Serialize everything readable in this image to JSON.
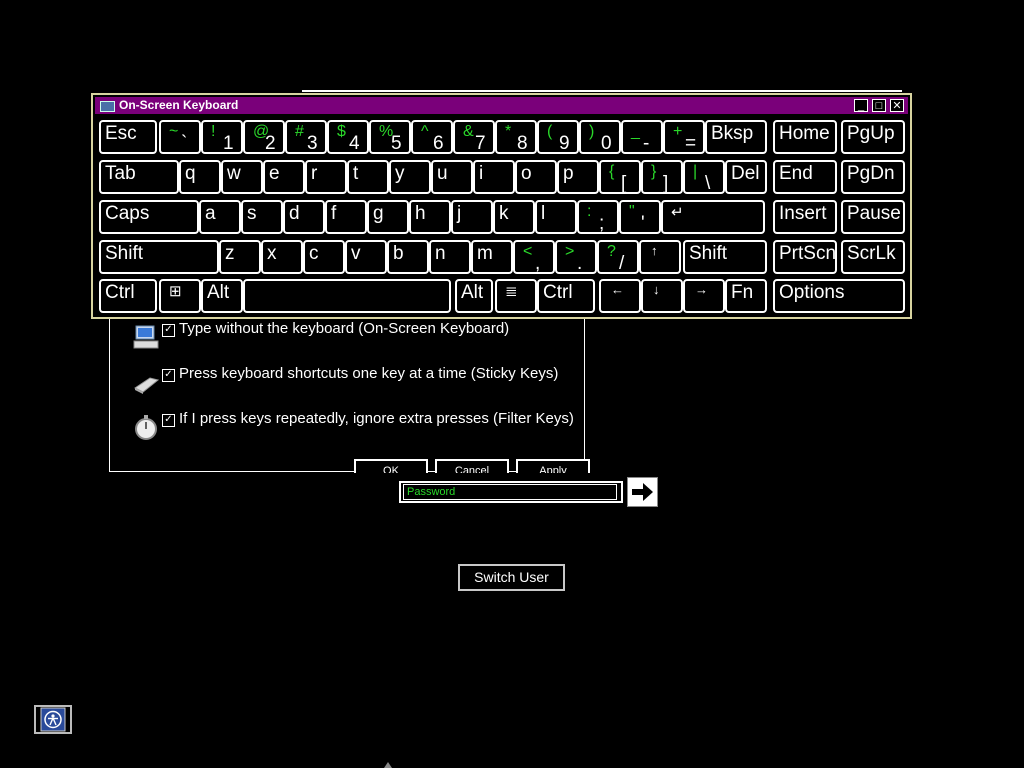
{
  "ease_dialog": {
    "options": [
      {
        "label": "Type without the keyboard (On-Screen Keyboard)",
        "checked": true,
        "icon": "monitor-keyboard-icon"
      },
      {
        "label": "Press keyboard shortcuts one key at a time (Sticky Keys)",
        "checked": true,
        "icon": "sticky-keys-icon"
      },
      {
        "label": "If I press keys repeatedly, ignore extra presses (Filter Keys)",
        "checked": true,
        "icon": "stopwatch-icon"
      }
    ],
    "buttons": {
      "ok": "OK",
      "cancel": "Cancel",
      "apply": "Apply"
    }
  },
  "osk": {
    "title": "On-Screen Keyboard",
    "rows": [
      [
        {
          "label": "Esc"
        },
        {
          "sup": "~",
          "sub": "`"
        },
        {
          "sup": "!",
          "sub": "1"
        },
        {
          "sup": "@",
          "sub": "2"
        },
        {
          "sup": "#",
          "sub": "3"
        },
        {
          "sup": "$",
          "sub": "4"
        },
        {
          "sup": "%",
          "sub": "5"
        },
        {
          "sup": "^",
          "sub": "6"
        },
        {
          "sup": "&",
          "sub": "7"
        },
        {
          "sup": "*",
          "sub": "8"
        },
        {
          "sup": "(",
          "sub": "9"
        },
        {
          "sup": ")",
          "sub": "0"
        },
        {
          "sup": "_",
          "sub": "-"
        },
        {
          "sup": "+",
          "sub": "="
        },
        {
          "label": "Bksp"
        },
        {
          "label": "Home"
        },
        {
          "label": "PgUp"
        }
      ],
      [
        {
          "label": "Tab"
        },
        {
          "label": "q"
        },
        {
          "label": "w"
        },
        {
          "label": "e"
        },
        {
          "label": "r"
        },
        {
          "label": "t"
        },
        {
          "label": "y"
        },
        {
          "label": "u"
        },
        {
          "label": "i"
        },
        {
          "label": "o"
        },
        {
          "label": "p"
        },
        {
          "sup": "{",
          "sub": "["
        },
        {
          "sup": "}",
          "sub": "]"
        },
        {
          "sup": "|",
          "sub": "\\"
        },
        {
          "label": "Del"
        },
        {
          "label": "End"
        },
        {
          "label": "PgDn"
        }
      ],
      [
        {
          "label": "Caps"
        },
        {
          "label": "a"
        },
        {
          "label": "s"
        },
        {
          "label": "d"
        },
        {
          "label": "f"
        },
        {
          "label": "g"
        },
        {
          "label": "h"
        },
        {
          "label": "j"
        },
        {
          "label": "k"
        },
        {
          "label": "l"
        },
        {
          "sup": ":",
          "sub": ";"
        },
        {
          "sup": "\"",
          "sub": "'"
        },
        {
          "label": "↵"
        },
        {
          "label": "Insert"
        },
        {
          "label": "Pause"
        }
      ],
      [
        {
          "label": "Shift"
        },
        {
          "label": "z"
        },
        {
          "label": "x"
        },
        {
          "label": "c"
        },
        {
          "label": "v"
        },
        {
          "label": "b"
        },
        {
          "label": "n"
        },
        {
          "label": "m"
        },
        {
          "sup": "<",
          "sub": ","
        },
        {
          "sup": ">",
          "sub": "."
        },
        {
          "sup": "?",
          "sub": "/"
        },
        {
          "small": "↑"
        },
        {
          "label": "Shift"
        },
        {
          "label": "PrtScn"
        },
        {
          "label": "ScrLk"
        }
      ],
      [
        {
          "label": "Ctrl"
        },
        {
          "label": "⊞"
        },
        {
          "label": "Alt"
        },
        {
          "label": ""
        },
        {
          "label": "Alt"
        },
        {
          "label": "≣"
        },
        {
          "label": "Ctrl"
        },
        {
          "small": "←"
        },
        {
          "small": "↓"
        },
        {
          "small": "→"
        },
        {
          "label": "Fn"
        },
        {
          "label": "Options"
        }
      ]
    ]
  },
  "login": {
    "password_placeholder": "Password",
    "switch_user_label": "Switch User"
  }
}
